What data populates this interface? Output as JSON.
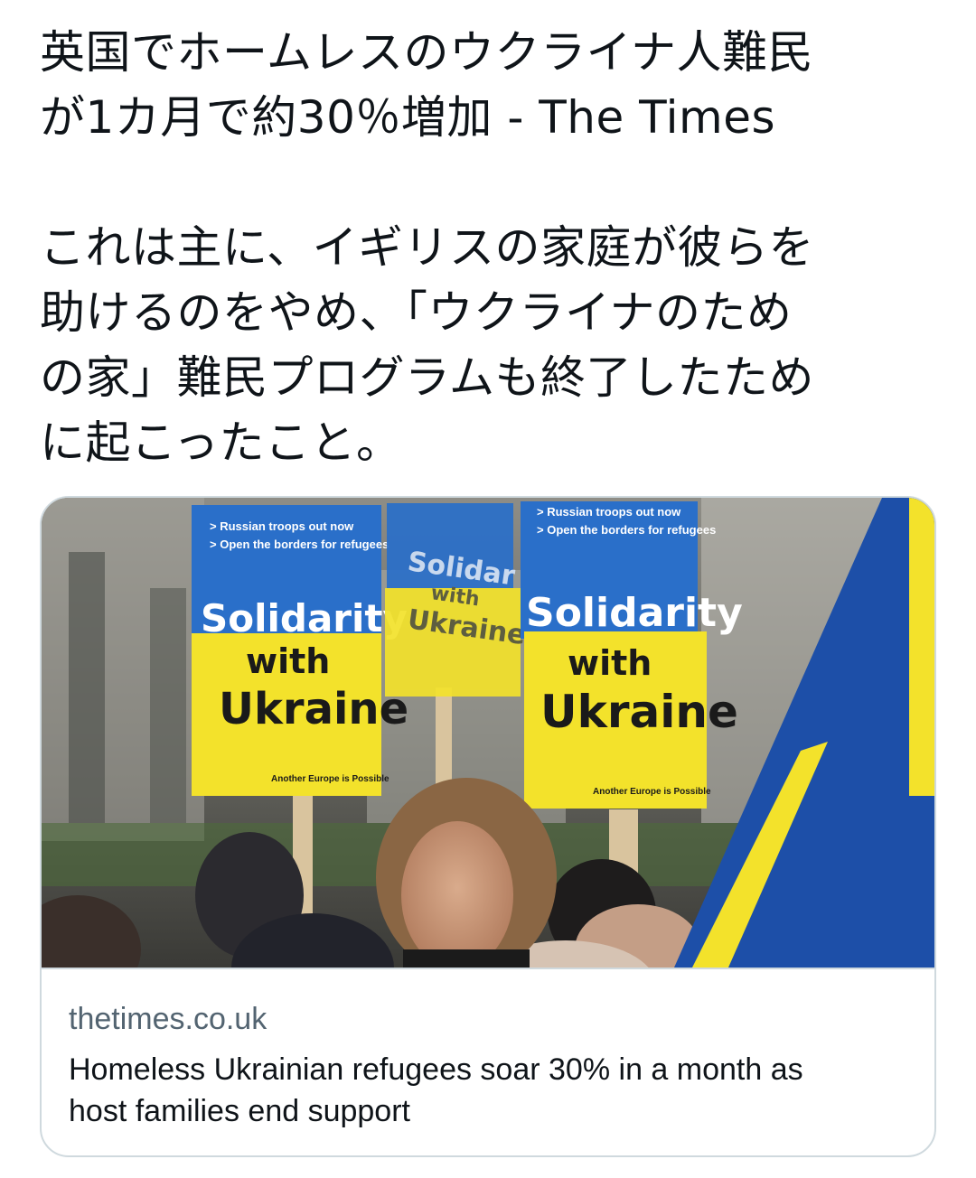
{
  "tweet": {
    "paragraph1": {
      "line1": "英国でホームレスのウクライナ人難民",
      "line2": "が1カ月で約30％増加 - The Times"
    },
    "paragraph2": {
      "line1": "これは主に、イギリスの家庭が彼らを",
      "line2": "助けるのをやめ、「ウクライナのため",
      "line3": "の家」難民プログラムも終了したため",
      "line4": "に起こったこと。"
    }
  },
  "link_card": {
    "domain": "thetimes.co.uk",
    "title_line1": "Homeless Ukrainian refugees soar 30% in a month as",
    "title_line2": "host families end support",
    "image": {
      "signs": {
        "left": {
          "line1": "> Russian troops out now",
          "line2": "> Open the borders for refugees",
          "headline1": "Solidarity",
          "headline2": "with",
          "headline3": "Ukraine",
          "footer": "Another Europe is Possible"
        },
        "middle": {
          "headline1": "Solidar",
          "headline2": "with",
          "headline3": "Ukraine"
        },
        "right": {
          "line1": "> Russian troops out now",
          "line2": "> Open the borders for refugees",
          "headline1": "Solidarity",
          "headline2": "with",
          "headline3": "Ukraine",
          "footer": "Another Europe is Possible"
        }
      },
      "colors": {
        "ukraine_blue": "#2a6fc9",
        "ukraine_yellow": "#f3e22b",
        "flag_blue": "#1d4fa8"
      }
    }
  }
}
